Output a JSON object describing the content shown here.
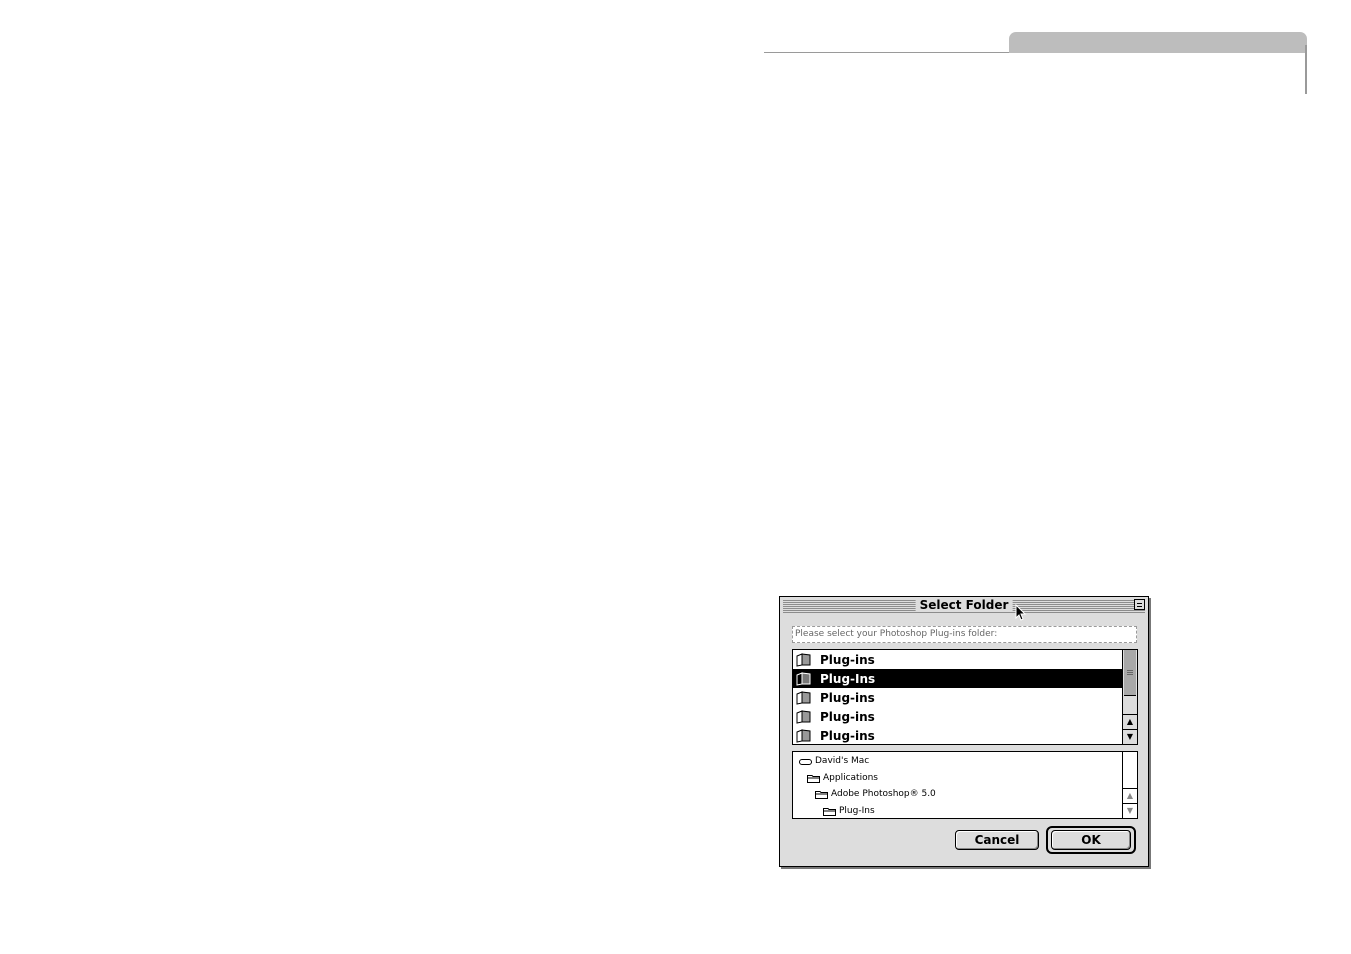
{
  "dialog": {
    "title": "Select Folder",
    "prompt": "Please select your Photoshop Plug-ins folder:",
    "files": [
      {
        "label": "Plug-ins",
        "selected": false
      },
      {
        "label": "Plug-Ins",
        "selected": true
      },
      {
        "label": "Plug-ins",
        "selected": false
      },
      {
        "label": "Plug-ins",
        "selected": false
      },
      {
        "label": "Plug-ins",
        "selected": false
      }
    ],
    "path": [
      {
        "label": "David's Mac",
        "icon": "hard-disk-icon"
      },
      {
        "label": "Applications",
        "icon": "folder-icon"
      },
      {
        "label": "Adobe Photoshop® 5.0",
        "icon": "folder-icon"
      },
      {
        "label": "Plug-Ins",
        "icon": "folder-icon"
      }
    ],
    "buttons": {
      "cancel": "Cancel",
      "ok": "OK"
    }
  },
  "colors": {
    "selection": "#000000",
    "dialog_bg": "#dddddd",
    "page_tab": "#bdbdbd"
  }
}
